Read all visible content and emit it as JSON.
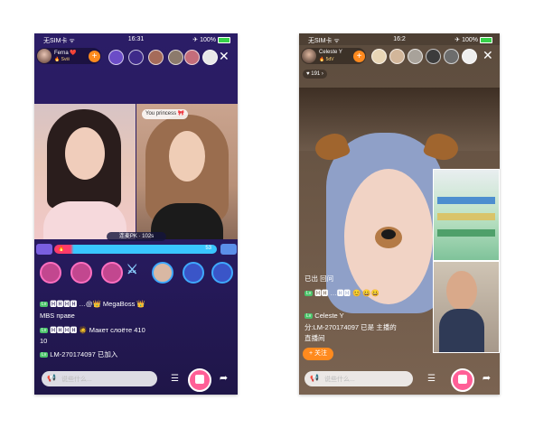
{
  "left_phone": {
    "status": {
      "carrier": "无SIM卡 ᯤ",
      "time": "16:31",
      "battery": "✈ 100%"
    },
    "host": {
      "name": "Ferna ❤️",
      "sub": "🔥 Sviii",
      "follow": "+"
    },
    "close": "✕",
    "pk_timer": "连麦PK · 102s",
    "pk_scores": {
      "left": "🔥",
      "right": "53"
    },
    "guest_caption": "You princess 🎀",
    "chat": [
      {
        "level": "Lv",
        "text": "🅷🅷🅷🅷 …@👑 MegaBoss 👑"
      },
      {
        "level": "",
        "text": "MBS праве"
      },
      {
        "level": "Lv",
        "text": "🅷🅷🅷🅷 🧔 Макет слоёте 410"
      },
      {
        "level": "",
        "text": "10"
      },
      {
        "level": "Lv",
        "text": "LM-270174097 已加入"
      }
    ],
    "input_placeholder": "说些什么..."
  },
  "right_phone": {
    "status": {
      "carrier": "无SIM卡 ᯤ",
      "time": "16:2",
      "battery": "✈ 100%"
    },
    "host": {
      "name": "Celeste Y",
      "sub": "🔥 5dV",
      "follow": "+"
    },
    "close": "✕",
    "likes": "♥ 191 ›",
    "chat": [
      {
        "level": "",
        "text": "已出 回问"
      },
      {
        "level": "Lv",
        "text": "🅷🅷 …🅷🅷 😊 😀😀"
      },
      {
        "level": "Lv",
        "text": "Celeste Y"
      },
      {
        "level": "",
        "text": "分:LM-270174097 已是 主播的"
      },
      {
        "level": "",
        "text": "直播间"
      }
    ],
    "tag_button": "+ 关注",
    "input_placeholder": "说些什么..."
  }
}
